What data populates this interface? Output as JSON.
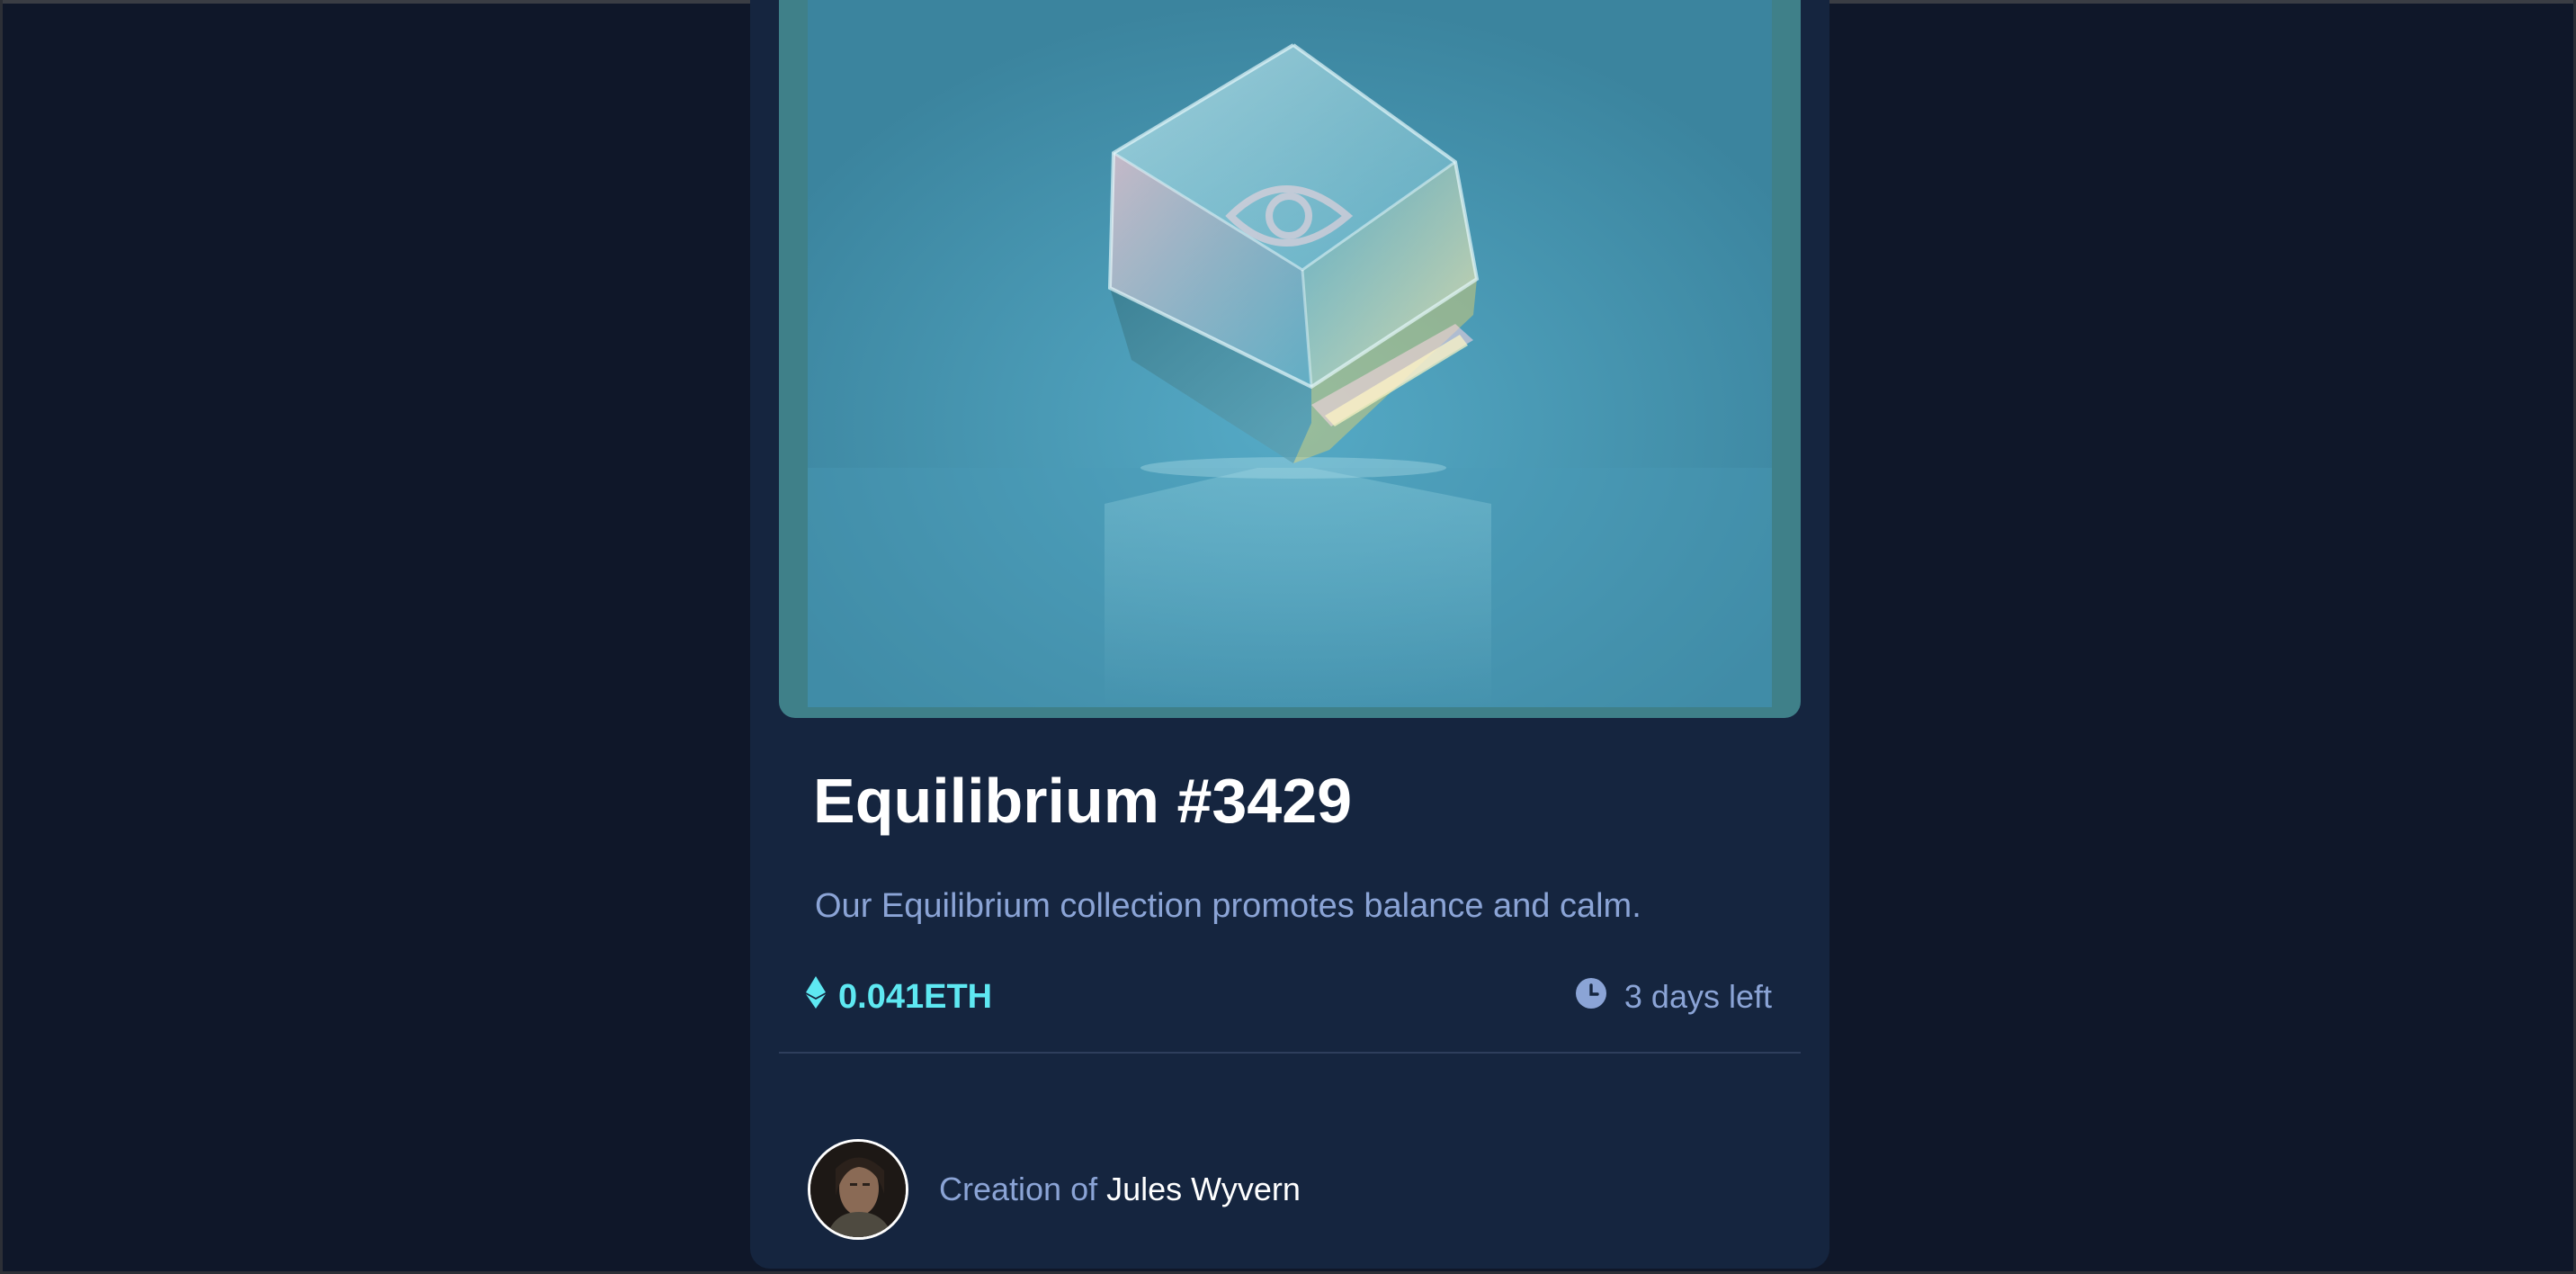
{
  "nft": {
    "title": "Equilibrium #3429",
    "description": "Our Equilibrium collection promotes balance and calm.",
    "price": "0.041ETH",
    "time_left": "3 days left"
  },
  "creator": {
    "prefix": "Creation of ",
    "name": "Jules Wyvern"
  },
  "icons": {
    "price": "ethereum-icon",
    "time": "clock-icon",
    "image_overlay": "eye-icon"
  },
  "colors": {
    "page_background": "#0f1729",
    "card_background": "#15253f",
    "accent_cyan": "#5ee8f2",
    "soft_blue_text": "#8ba4d6",
    "divider": "#2e3e5c"
  }
}
